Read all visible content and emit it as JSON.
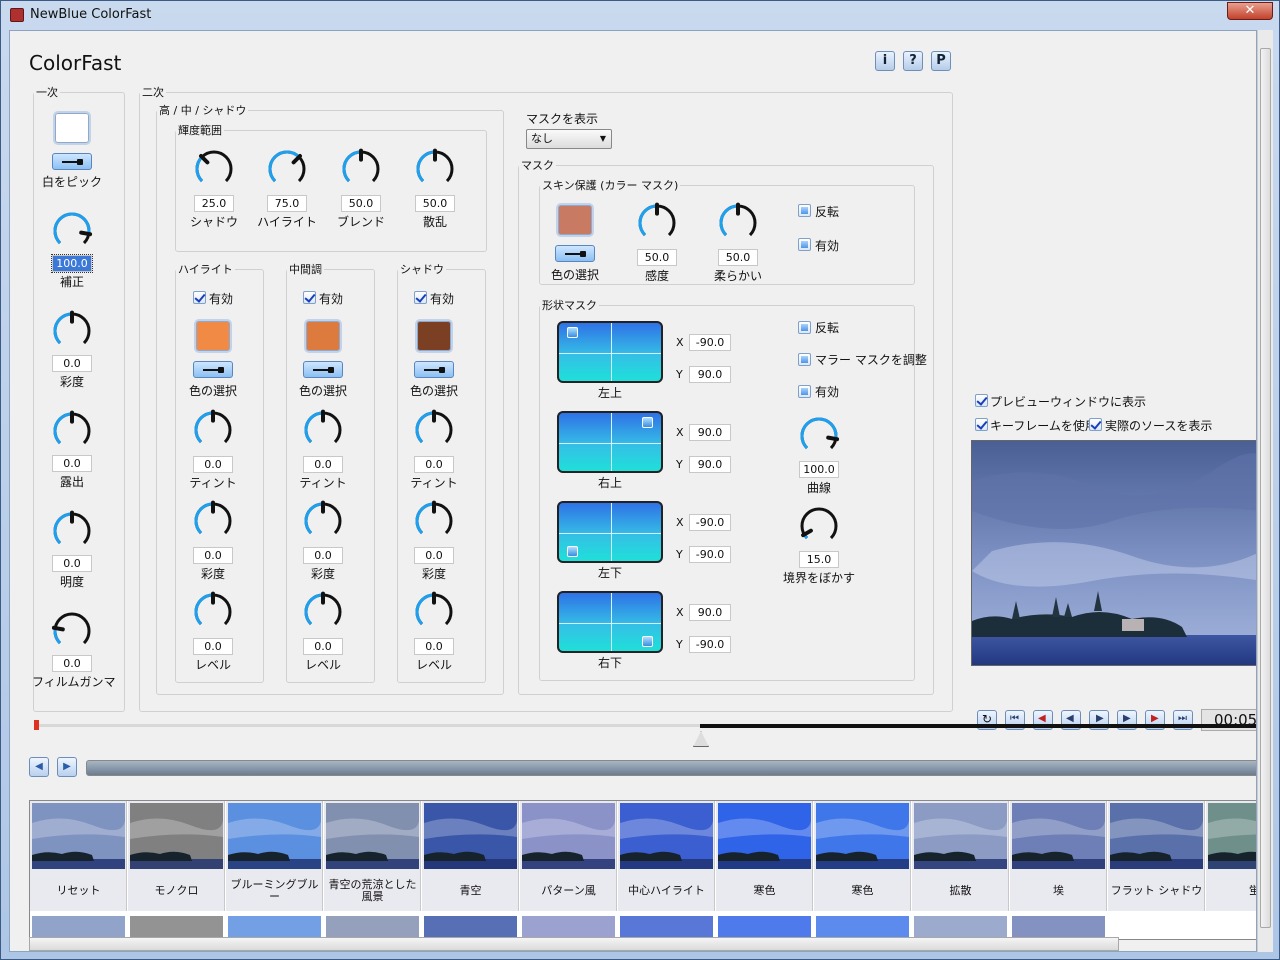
{
  "window": {
    "title": "NewBlue ColorFast",
    "close_glyph": "✕"
  },
  "header": {
    "app_title": "ColorFast",
    "btn_info": "i",
    "btn_help": "?",
    "btn_p": "P"
  },
  "primary": {
    "legend": "一次",
    "pick_white_label": "白をピック",
    "correction": {
      "value": "100.0",
      "label": "補正"
    },
    "saturation": {
      "value": "0.0",
      "label": "彩度"
    },
    "exposure": {
      "value": "0.0",
      "label": "露出"
    },
    "brightness": {
      "value": "0.0",
      "label": "明度"
    },
    "film_gamma": {
      "value": "0.0",
      "label": "フィルムガンマ"
    }
  },
  "secondary": {
    "legend": "二次",
    "hms_legend": "高 / 中 / シャドウ",
    "luma_legend": "輝度範囲",
    "luma": [
      {
        "value": "25.0",
        "label": "シャドウ"
      },
      {
        "value": "75.0",
        "label": "ハイライト"
      },
      {
        "value": "50.0",
        "label": "ブレンド"
      },
      {
        "value": "50.0",
        "label": "散乱"
      }
    ],
    "columns": [
      {
        "legend": "ハイライト",
        "enabled": "有効",
        "color_label": "色の選択",
        "color": "#f08a45",
        "tint": "0.0",
        "tint_label": "ティント",
        "sat": "0.0",
        "sat_label": "彩度",
        "level": "0.0",
        "level_label": "レベル"
      },
      {
        "legend": "中間調",
        "enabled": "有効",
        "color_label": "色の選択",
        "color": "#dd7a3e",
        "tint": "0.0",
        "tint_label": "ティント",
        "sat": "0.0",
        "sat_label": "彩度",
        "level": "0.0",
        "level_label": "レベル"
      },
      {
        "legend": "シャドウ",
        "enabled": "有効",
        "color_label": "色の選択",
        "color": "#7b3f24",
        "tint": "0.0",
        "tint_label": "ティント",
        "sat": "0.0",
        "sat_label": "彩度",
        "level": "0.0",
        "level_label": "レベル"
      }
    ]
  },
  "mask": {
    "show_label": "マスクを表示",
    "show_value": "なし",
    "legend": "マスク",
    "skin": {
      "legend": "スキン保護 (カラー マスク)",
      "color": "#c97a63",
      "color_label": "色の選択",
      "sensitivity": {
        "value": "50.0",
        "label": "感度"
      },
      "softness": {
        "value": "50.0",
        "label": "柔らかい"
      },
      "invert": "反転",
      "enabled": "有効"
    },
    "shape": {
      "legend": "形状マスク",
      "corners": [
        {
          "label": "左上",
          "x": "-90.0",
          "y": "90.0"
        },
        {
          "label": "右上",
          "x": "90.0",
          "y": "90.0"
        },
        {
          "label": "左下",
          "x": "-90.0",
          "y": "-90.0"
        },
        {
          "label": "右下",
          "x": "90.0",
          "y": "-90.0"
        }
      ],
      "x_label": "X",
      "y_label": "Y",
      "invert": "反転",
      "mirror": "マラー マスクを調整",
      "enabled": "有効",
      "curve": {
        "value": "100.0",
        "label": "曲線"
      },
      "feather": {
        "value": "15.0",
        "label": "境界をぼかす"
      }
    }
  },
  "preview": {
    "show_preview": "プレビューウィンドウに表示",
    "use_keyframes": "キーフレームを使用",
    "show_source": "実際のソースを表示",
    "timecode": "00:05"
  },
  "presets": [
    {
      "name": "リセット",
      "tint": "#7f93c0"
    },
    {
      "name": "モノクロ",
      "tint": "#808080"
    },
    {
      "name": "ブルーミングブルー",
      "tint": "#5b8fe0"
    },
    {
      "name": "青空の荒涼とした風景",
      "tint": "#8290b0"
    },
    {
      "name": "青空",
      "tint": "#3a56a8"
    },
    {
      "name": "パターン風",
      "tint": "#8a92c8"
    },
    {
      "name": "中心ハイライト",
      "tint": "#3b5fd0"
    },
    {
      "name": "寒色",
      "tint": "#2f63e8"
    },
    {
      "name": "寒色",
      "tint": "#3f76ea"
    },
    {
      "name": "拡散",
      "tint": "#8b9bc4"
    },
    {
      "name": "埃",
      "tint": "#6d7fb6"
    },
    {
      "name": "フラット シャドウ",
      "tint": "#5a70aa"
    },
    {
      "name": "蛍",
      "tint": "#6f8f8a"
    }
  ],
  "colors": {
    "accent": "#1ea0f0",
    "knob": "#111111"
  }
}
